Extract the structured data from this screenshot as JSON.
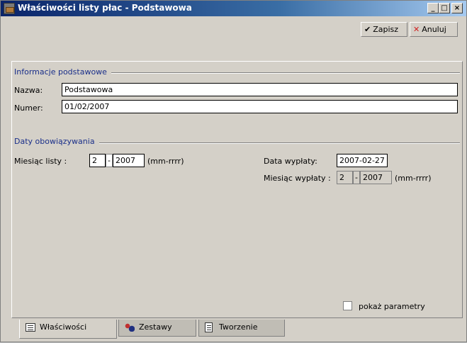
{
  "window": {
    "title": "Właściwości listy płac - Podstawowa",
    "min_label": "_",
    "max_label": "□",
    "close_label": "×"
  },
  "toolbar": {
    "save_label": "Zapisz",
    "cancel_label": "Anuluj",
    "save_icon": "check-icon",
    "cancel_icon": "x-icon"
  },
  "basic_info": {
    "section_title": "Informacje podstawowe",
    "name_label": "Nazwa:",
    "name_value": "Podstawowa",
    "number_label": "Numer:",
    "number_value": "01/02/2007"
  },
  "validity": {
    "section_title": "Daty obowiązywania",
    "list_month_label": "Miesiąc listy :",
    "list_month_month": "2",
    "list_month_year": "2007",
    "list_month_format": "(mm-rrrr)",
    "payment_date_label": "Data wypłaty:",
    "payment_date_value": "2007-02-27",
    "payment_month_label": "Miesiąc wypłaty :",
    "payment_month_month": "2",
    "payment_month_year": "2007",
    "payment_month_format": "(mm-rrrr)",
    "separator": "-"
  },
  "options": {
    "show_params_label": "pokaż parametry",
    "show_params_checked": false
  },
  "tabs": [
    {
      "label": "Właściwości",
      "icon": "list-icon",
      "active": true
    },
    {
      "label": "Zestawy",
      "icon": "sets-icon",
      "active": false
    },
    {
      "label": "Tworzenie",
      "icon": "document-icon",
      "active": false
    }
  ],
  "colors": {
    "section_title": "#1a2f8a",
    "titlebar_start": "#0a246a",
    "cancel_icon": "#d02020"
  }
}
